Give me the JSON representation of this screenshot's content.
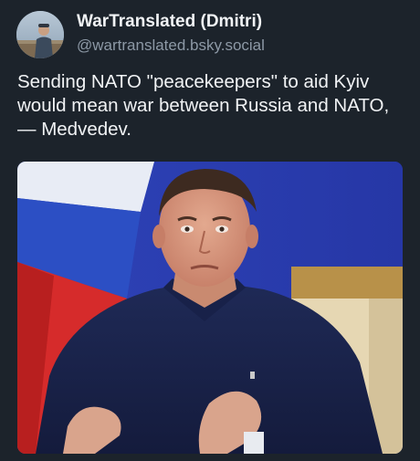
{
  "post": {
    "author": {
      "display_name": "WarTranslated (Dmitri)",
      "handle": "@wartranslated.bsky.social",
      "avatar_icon": "profile-photo"
    },
    "text": "Sending NATO \"peacekeepers\" to aid Kyiv would mean war between Russia and NATO, — Medvedev.",
    "image": {
      "kind": "photo",
      "subject": "man in dark suit gesturing in front of Russian flag"
    }
  },
  "colors": {
    "background": "#1c232b",
    "text_primary": "#f1f3f5",
    "text_secondary": "#8d99a6"
  }
}
